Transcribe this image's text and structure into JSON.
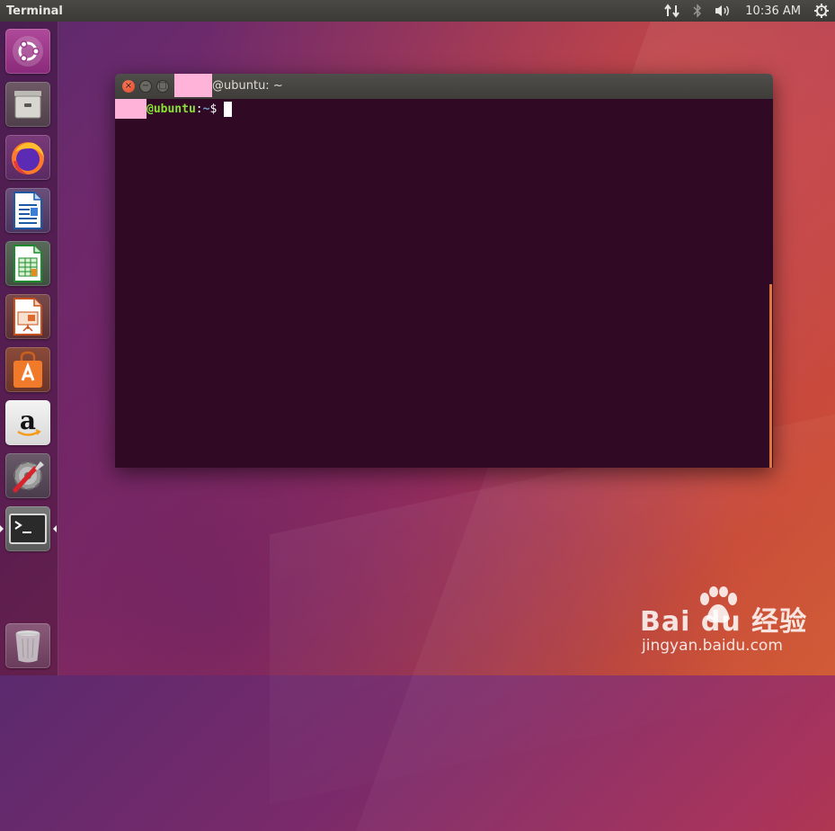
{
  "top_panel": {
    "app_title": "Terminal",
    "time": "10:36 AM",
    "icons": [
      "network-icon",
      "bluetooth-icon",
      "volume-icon",
      "power-gear-icon"
    ]
  },
  "launcher": {
    "items": [
      {
        "name": "ubuntu-dash",
        "icon": "ubuntu-logo-icon"
      },
      {
        "name": "files",
        "icon": "file-cabinet-icon"
      },
      {
        "name": "firefox",
        "icon": "firefox-icon"
      },
      {
        "name": "libreoffice-writer",
        "icon": "writer-icon"
      },
      {
        "name": "libreoffice-calc",
        "icon": "calc-icon"
      },
      {
        "name": "libreoffice-impress",
        "icon": "impress-icon"
      },
      {
        "name": "ubuntu-software",
        "icon": "software-bag-icon"
      },
      {
        "name": "amazon",
        "icon": "amazon-icon"
      },
      {
        "name": "system-settings",
        "icon": "settings-gear-icon"
      },
      {
        "name": "terminal",
        "icon": "terminal-icon",
        "active": true
      },
      {
        "name": "trash",
        "icon": "trash-icon"
      }
    ]
  },
  "window": {
    "title": "@ubuntu: ~",
    "close_glyph": "×",
    "min_glyph": "−",
    "max_glyph": "□"
  },
  "terminal": {
    "prompt_host": "@ubuntu",
    "prompt_sep": ":",
    "prompt_path": "~",
    "prompt_symbol": "$",
    "colors": {
      "background": "#300a24",
      "host": "#8ae234",
      "path": "#729fcf"
    }
  },
  "watermark": {
    "brand": "Bai du 经验",
    "url": "jingyan.baidu.com"
  }
}
